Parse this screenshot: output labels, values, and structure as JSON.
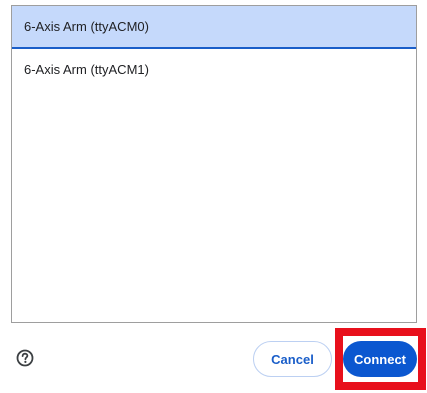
{
  "device_list": {
    "items": [
      {
        "label": "6-Axis Arm (ttyACM0)",
        "selected": true
      },
      {
        "label": "6-Axis Arm (ttyACM1)",
        "selected": false
      }
    ]
  },
  "footer": {
    "help_icon": "question-circle-icon",
    "cancel_label": "Cancel",
    "connect_label": "Connect"
  },
  "colors": {
    "accent": "#0b57d0",
    "selected_bg": "#c5d9fb",
    "highlight": "#e8101c"
  }
}
